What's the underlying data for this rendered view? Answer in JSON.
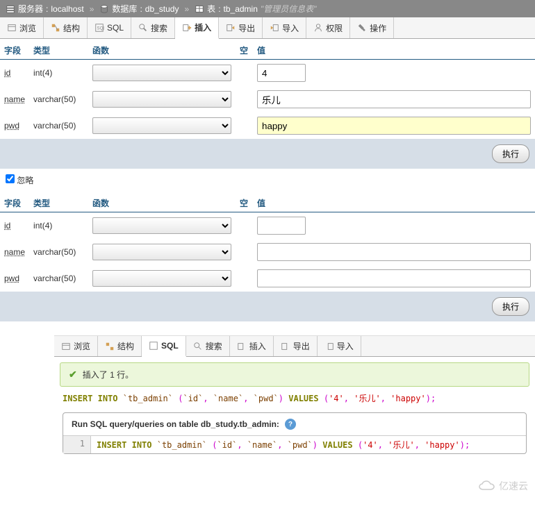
{
  "breadcrumb": {
    "server_label": "服务器",
    "server_value": "localhost",
    "db_label": "数据库",
    "db_value": "db_study",
    "table_label": "表",
    "table_value": "tb_admin",
    "comment": "\"管理员信息表\""
  },
  "tabs": {
    "browse": "浏览",
    "structure": "结构",
    "sql": "SQL",
    "search": "搜索",
    "insert": "插入",
    "export": "导出",
    "import": "导入",
    "privileges": "权限",
    "operations": "操作"
  },
  "headers": {
    "field": "字段",
    "type": "类型",
    "function": "函数",
    "null": "空",
    "value": "值"
  },
  "rows1": [
    {
      "field": "id",
      "type": "int(4)",
      "value": "4",
      "small": true,
      "highlight": false
    },
    {
      "field": "name",
      "type": "varchar(50)",
      "value": "乐儿",
      "small": false,
      "highlight": false
    },
    {
      "field": "pwd",
      "type": "varchar(50)",
      "value": "happy",
      "small": false,
      "highlight": true
    }
  ],
  "rows2": [
    {
      "field": "id",
      "type": "int(4)",
      "value": "",
      "small": true
    },
    {
      "field": "name",
      "type": "varchar(50)",
      "value": "",
      "small": false
    },
    {
      "field": "pwd",
      "type": "varchar(50)",
      "value": "",
      "small": false
    }
  ],
  "execute_label": "执行",
  "ignore_label": "忽略",
  "success": {
    "message": "插入了 1 行。"
  },
  "sql": {
    "insert": "INSERT",
    "into": "INTO",
    "table": "`tb_admin`",
    "open": "(",
    "close": ")",
    "c1": "`id`",
    "c2": "`name`",
    "c3": "`pwd`",
    "values": "VALUES",
    "v1": "'4'",
    "v2": "'乐儿'",
    "v3": "'happy'",
    "comma": ",",
    "semi": ";"
  },
  "query_panel": {
    "title": "Run SQL query/queries on table db_study.tb_admin:",
    "line_num": "1"
  },
  "watermark": "亿速云"
}
